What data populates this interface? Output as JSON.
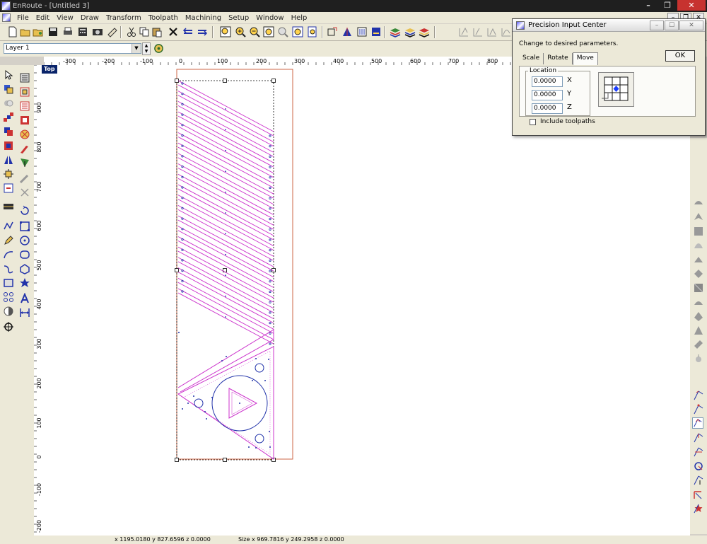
{
  "window": {
    "title": "EnRoute - [Untitled 3]"
  },
  "menu": [
    "File",
    "Edit",
    "View",
    "Draw",
    "Transform",
    "Toolpath",
    "Machining",
    "Setup",
    "Window",
    "Help"
  ],
  "layer": {
    "name": "Layer 1"
  },
  "view": {
    "label": "Top"
  },
  "ruler": {
    "h_ticks": [
      "-300",
      "-200",
      "-100",
      "0",
      "100",
      "200",
      "300",
      "400",
      "500",
      "600",
      "700",
      "800"
    ],
    "v_ticks": [
      "900",
      "800",
      "700",
      "600",
      "500",
      "400",
      "300",
      "200",
      "100",
      "0",
      "-100",
      "-200"
    ]
  },
  "status": {
    "cursor": "x 1195.0180 y 827.6596 z 0.0000",
    "size": "Size x 969.7816 y 249.2958 z 0.0000"
  },
  "dialog": {
    "title": "Precision Input Center",
    "prompt": "Change to desired parameters.",
    "ok_label": "OK",
    "tabs": [
      "Scale",
      "Rotate",
      "Move"
    ],
    "active_tab": "Move",
    "group_label": "Location",
    "fields": [
      {
        "label": "X",
        "value": "0.0000"
      },
      {
        "label": "Y",
        "value": "0.0000"
      },
      {
        "label": "Z",
        "value": "0.0000"
      }
    ],
    "checkbox_label": "Include toolpaths",
    "checkbox_checked": false
  },
  "colors": {
    "selection": "#000000",
    "magenta": "#cc33cc",
    "blue": "#2233aa",
    "material": "#cc6644",
    "title_bar": "#1f1f1f",
    "chrome": "#ece9d8"
  }
}
